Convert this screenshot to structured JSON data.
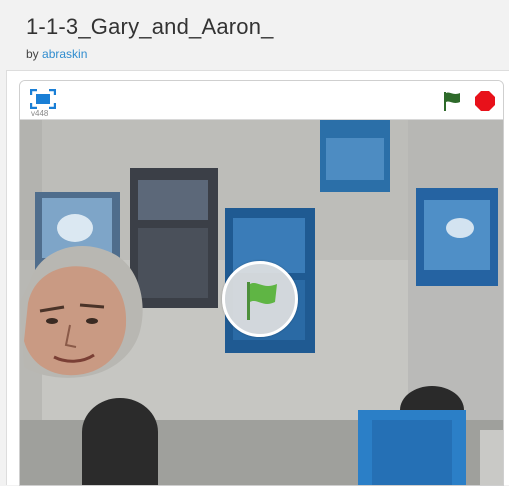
{
  "project": {
    "title": "1-1-3_Gary_and_Aaron_",
    "by_label": "by",
    "author": "abraskin"
  },
  "player": {
    "version": "v448",
    "icons": {
      "fullscreen": "fullscreen-icon",
      "green_flag": "green-flag-icon",
      "stop": "stop-icon",
      "center_flag": "green-flag-icon"
    },
    "colors": {
      "accent": "#1a7fd6",
      "flag_green": "#4caf3a",
      "flag_dark_green": "#2e6a2a",
      "stop_red": "#e8111a"
    }
  }
}
